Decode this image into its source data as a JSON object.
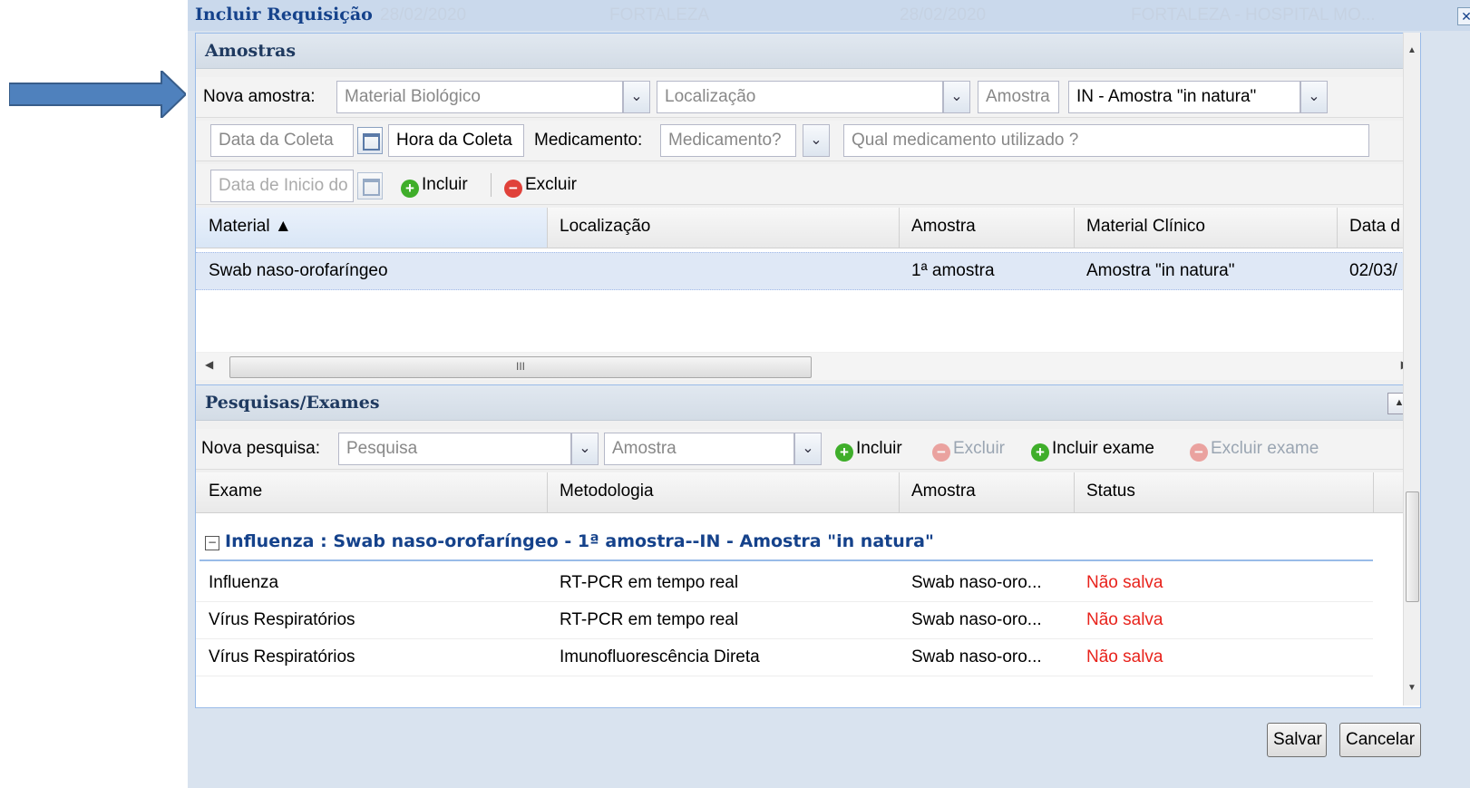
{
  "colors": {
    "titlebar": "#cad9ec",
    "panel_border": "#99bbe8",
    "status_red": "#e8231c",
    "group_blue": "#15428b",
    "arrow": "#4f81bd"
  },
  "window": {
    "title": "Incluir Requisição",
    "ghost_texts": [
      "28/02/2020",
      "FORTALEZA",
      "28/02/2020",
      "FORTALEZA - HOSPITAL MO..."
    ],
    "close_icon": "close-icon"
  },
  "amostras": {
    "title": "Amostras",
    "nova_amostra_label": "Nova amostra:",
    "material_placeholder": "Material Biológico",
    "localizacao_placeholder": "Localização",
    "amostra_label": "Amostra",
    "amostra_value": "IN - Amostra \"in natura\"",
    "data_coleta_placeholder": "Data da Coleta",
    "hora_coleta_placeholder": "Hora da Coleta",
    "medicamento_label": "Medicamento:",
    "medicamento_placeholder": "Medicamento?",
    "qual_medicamento_placeholder": "Qual medicamento utilizado ?",
    "data_inicio_placeholder": "Data de Inicio do",
    "incluir_label": "Incluir",
    "excluir_label": "Excluir",
    "columns": [
      "Material ▲",
      "Localização",
      "Amostra",
      "Material Clínico",
      "Data d"
    ],
    "rows": [
      {
        "material": "Swab naso-orofaríngeo",
        "localizacao": "",
        "amostra": "1ª amostra",
        "material_clinico": "Amostra \"in natura\"",
        "data": "02/03/"
      }
    ],
    "scroll_grip": "III"
  },
  "pesquisas": {
    "title": "Pesquisas/Exames",
    "nova_pesquisa_label": "Nova pesquisa:",
    "pesquisa_placeholder": "Pesquisa",
    "amostra_placeholder": "Amostra",
    "incluir_label": "Incluir",
    "excluir_label": "Excluir",
    "incluir_exame_label": "Incluir exame",
    "excluir_exame_label": "Excluir exame",
    "columns": [
      "Exame",
      "Metodologia",
      "Amostra",
      "Status"
    ],
    "group_label": "Influenza : Swab naso-orofaríngeo - 1ª amostra--IN - Amostra \"in natura\"",
    "rows": [
      {
        "exame": "Influenza",
        "metodologia": "RT-PCR em tempo real",
        "amostra": "Swab naso-oro...",
        "status": "Não salva"
      },
      {
        "exame": "Vírus Respiratórios",
        "metodologia": "RT-PCR em tempo real",
        "amostra": "Swab naso-oro...",
        "status": "Não salva"
      },
      {
        "exame": "Vírus Respiratórios",
        "metodologia": "Imunofluorescência Direta",
        "amostra": "Swab naso-oro...",
        "status": "Não salva"
      }
    ]
  },
  "footer": {
    "salvar_label": "Salvar",
    "cancelar_label": "Cancelar"
  }
}
